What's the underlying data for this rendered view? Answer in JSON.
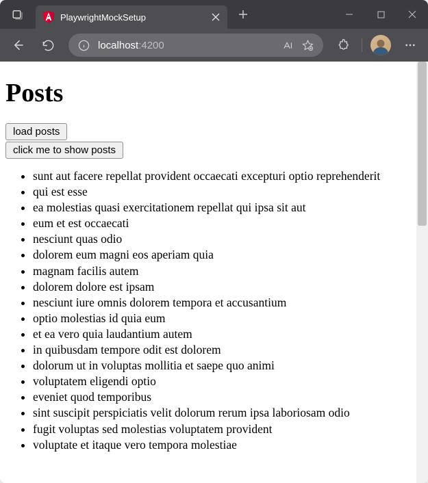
{
  "browser": {
    "tab": {
      "title": "PlaywrightMockSetup"
    },
    "address": {
      "host": "localhost",
      "port": ":4200"
    }
  },
  "page": {
    "heading": "Posts",
    "buttons": {
      "load": "load posts",
      "show": "click me to show posts"
    },
    "posts": [
      "sunt aut facere repellat provident occaecati excepturi optio reprehenderit",
      "qui est esse",
      "ea molestias quasi exercitationem repellat qui ipsa sit aut",
      "eum et est occaecati",
      "nesciunt quas odio",
      "dolorem eum magni eos aperiam quia",
      "magnam facilis autem",
      "dolorem dolore est ipsam",
      "nesciunt iure omnis dolorem tempora et accusantium",
      "optio molestias id quia eum",
      "et ea vero quia laudantium autem",
      "in quibusdam tempore odit est dolorem",
      "dolorum ut in voluptas mollitia et saepe quo animi",
      "voluptatem eligendi optio",
      "eveniet quod temporibus",
      "sint suscipit perspiciatis velit dolorum rerum ipsa laboriosam odio",
      "fugit voluptas sed molestias voluptatem provident",
      "voluptate et itaque vero tempora molestiae"
    ]
  }
}
